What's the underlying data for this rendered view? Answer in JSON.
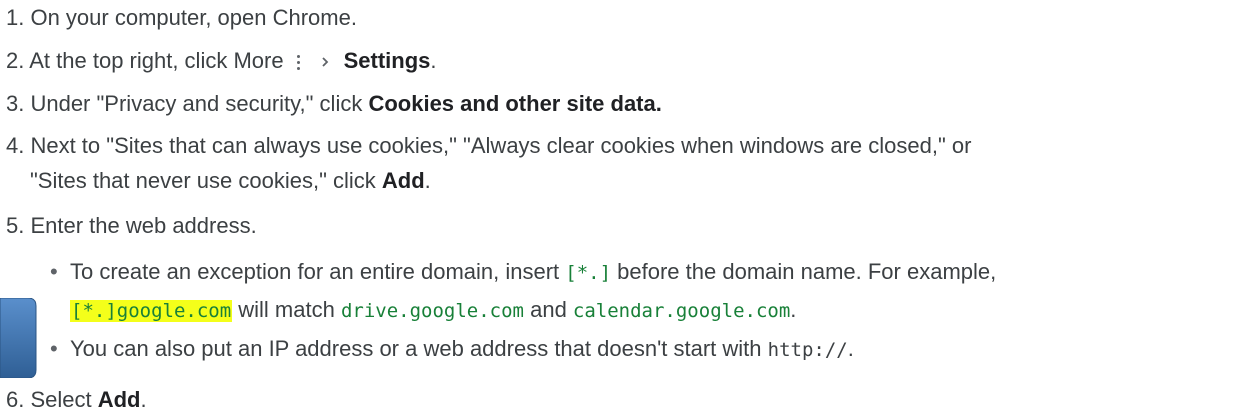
{
  "steps": {
    "s1": {
      "text": "1. On your computer, open Chrome."
    },
    "s2": {
      "pre": "2. At the top right, click More",
      "bold": "Settings",
      "post": "."
    },
    "s3": {
      "pre": "3. Under \"Privacy and security,\" click ",
      "bold": "Cookies and other site data."
    },
    "s4": {
      "line1": "4. Next to \"Sites that can always use cookies,\" \"Always clear cookies when windows are closed,\" or",
      "line2_pre": "\"Sites that never use cookies,\" click ",
      "line2_bold": "Add",
      "line2_post": "."
    },
    "s5": {
      "text": "5. Enter the web address."
    },
    "s5_bullets": {
      "b1_pre": "To create an exception for an entire domain, insert ",
      "b1_code": "[*.]",
      "b1_post": " before the domain name. For example,",
      "b1_highlight": "[*.]google.com",
      "b1_mid": " will match ",
      "b1_code2": "drive.google.com",
      "b1_and": " and ",
      "b1_code3": "calendar.google.com",
      "b1_end": ".",
      "b2_pre": "You can also put an IP address or a web address that doesn't start with ",
      "b2_code": "http://",
      "b2_end": "."
    },
    "s6": {
      "pre": "6. Select ",
      "bold": "Add",
      "post": "."
    }
  },
  "bullet_glyph": "•",
  "icons": {
    "more": "more-vert-icon",
    "chevron": "chevron-right-icon"
  },
  "colors": {
    "text": "#3c4043",
    "bold_text": "#202124",
    "code": "#188038",
    "highlight": "#f4ff1a",
    "arrow_fill": "#3f78b5"
  }
}
